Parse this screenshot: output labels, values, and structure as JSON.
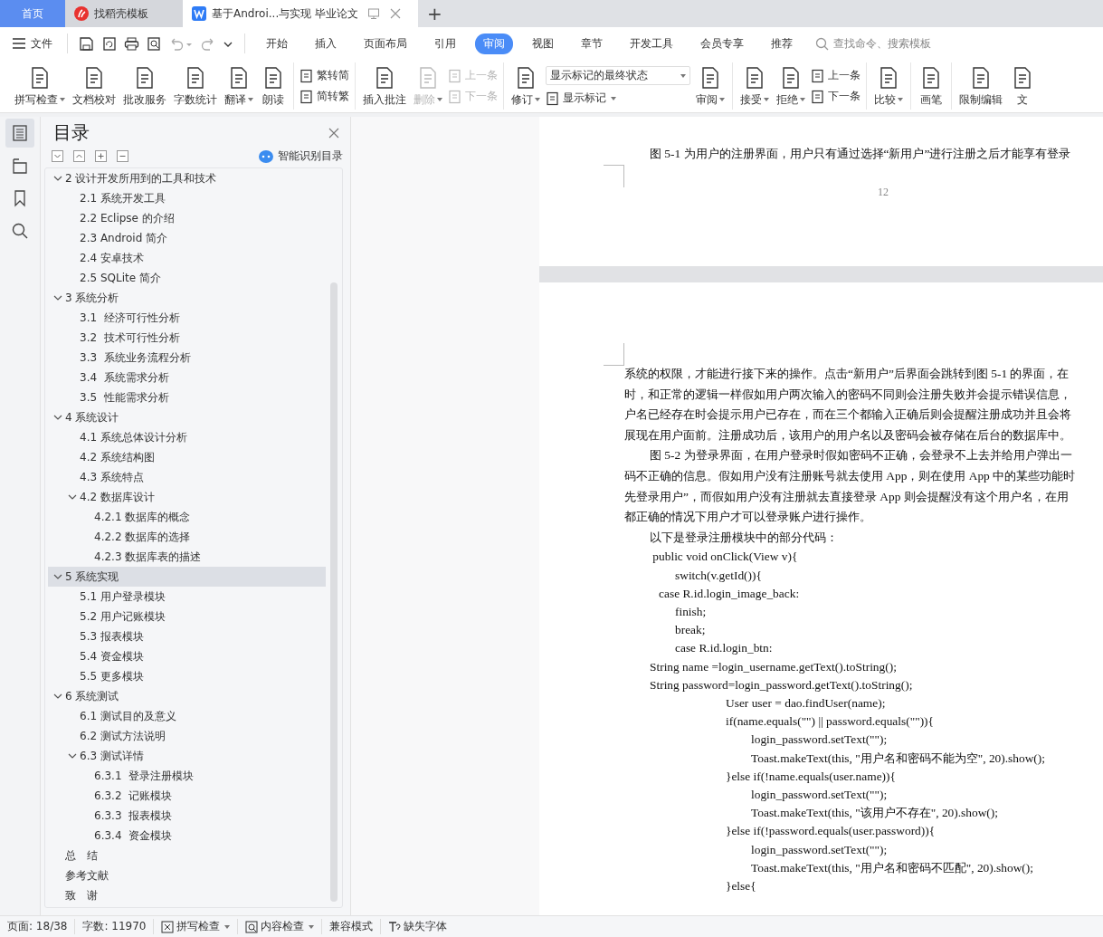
{
  "tabs": [
    {
      "label": "首页",
      "kind": "home",
      "selected": false
    },
    {
      "label": "找稻壳模板",
      "kind": "app",
      "selected": false
    },
    {
      "label": "基于Androi...与实现 毕业论文",
      "kind": "doc",
      "selected": true
    }
  ],
  "new_tab": "+",
  "menu": {
    "file": "文件",
    "tabs": [
      {
        "label": "开始",
        "selected": false
      },
      {
        "label": "插入",
        "selected": false
      },
      {
        "label": "页面布局",
        "selected": false
      },
      {
        "label": "引用",
        "selected": false
      },
      {
        "label": "审阅",
        "selected": true
      },
      {
        "label": "视图",
        "selected": false
      },
      {
        "label": "章节",
        "selected": false
      },
      {
        "label": "开发工具",
        "selected": false
      },
      {
        "label": "会员专享",
        "selected": false
      },
      {
        "label": "推荐",
        "selected": false
      }
    ],
    "search_placeholder": "查找命令、搜索模板"
  },
  "ribbon": [
    {
      "items": [
        {
          "kind": "large",
          "label": "拼写检查",
          "dropdown": true,
          "disabled": false
        },
        {
          "kind": "large",
          "label": "文档校对",
          "dropdown": false,
          "disabled": false
        },
        {
          "kind": "large",
          "label": "批改服务",
          "dropdown": false,
          "disabled": false
        },
        {
          "kind": "large",
          "label": "字数统计",
          "dropdown": false,
          "disabled": false
        },
        {
          "kind": "large",
          "label": "翻译",
          "dropdown": true,
          "disabled": false
        },
        {
          "kind": "large",
          "label": "朗读",
          "dropdown": false,
          "disabled": false
        }
      ]
    },
    {
      "items": [
        {
          "kind": "stack",
          "items": [
            {
              "label": "繁转简",
              "dropdown": false,
              "disabled": false
            },
            {
              "label": "简转繁",
              "dropdown": false,
              "disabled": false
            }
          ]
        }
      ]
    },
    {
      "items": [
        {
          "kind": "large",
          "label": "插入批注",
          "dropdown": false,
          "disabled": false
        },
        {
          "kind": "large",
          "label": "删除",
          "dropdown": true,
          "disabled": true
        },
        {
          "kind": "stack",
          "items": [
            {
              "label": "上一条",
              "dropdown": false,
              "disabled": true
            },
            {
              "label": "下一条",
              "dropdown": false,
              "disabled": true
            }
          ]
        }
      ]
    },
    {
      "items": [
        {
          "kind": "large",
          "label": "修订",
          "dropdown": true,
          "disabled": false
        },
        {
          "kind": "select",
          "value": "显示标记的最终状态",
          "items": [
            {
              "label": "显示标记",
              "dropdown": true,
              "disabled": false
            }
          ]
        },
        {
          "kind": "large",
          "label": "审阅",
          "dropdown": true,
          "disabled": false
        }
      ]
    },
    {
      "items": [
        {
          "kind": "large",
          "label": "接受",
          "dropdown": true,
          "disabled": false
        },
        {
          "kind": "large",
          "label": "拒绝",
          "dropdown": true,
          "disabled": false
        },
        {
          "kind": "stack",
          "items": [
            {
              "label": "上一条",
              "dropdown": false,
              "disabled": false
            },
            {
              "label": "下一条",
              "dropdown": false,
              "disabled": false
            }
          ]
        }
      ]
    },
    {
      "items": [
        {
          "kind": "large",
          "label": "比较",
          "dropdown": true,
          "disabled": false
        }
      ]
    },
    {
      "items": [
        {
          "kind": "large",
          "label": "画笔",
          "dropdown": false,
          "disabled": false
        }
      ]
    },
    {
      "items": [
        {
          "kind": "large",
          "label": "限制编辑",
          "dropdown": false,
          "disabled": false
        },
        {
          "kind": "large",
          "label": "文",
          "dropdown": false,
          "disabled": false
        }
      ]
    }
  ],
  "rail": [
    {
      "selected": true
    },
    {
      "selected": false
    },
    {
      "selected": false
    },
    {
      "selected": false
    }
  ],
  "toc": {
    "title": "目录",
    "smart_label": "智能识别目录",
    "items": [
      {
        "label": "2 设计开发所用到的工具和技术",
        "selected": false,
        "expanded": true,
        "children": [
          {
            "label": "2.1 系统开发工具",
            "selected": false
          },
          {
            "label": "2.2 Eclipse 的介绍",
            "selected": false
          },
          {
            "label": "2.3 Android 简介",
            "selected": false
          },
          {
            "label": "2.4 安卓技术",
            "selected": false
          },
          {
            "label": "2.5 SQLite 简介",
            "selected": false
          }
        ]
      },
      {
        "label": "3 系统分析",
        "selected": false,
        "expanded": true,
        "children": [
          {
            "label": "3.1  经济可行性分析",
            "selected": false
          },
          {
            "label": "3.2  技术可行性分析",
            "selected": false
          },
          {
            "label": "3.3  系统业务流程分析",
            "selected": false
          },
          {
            "label": "3.4  系统需求分析",
            "selected": false
          },
          {
            "label": "3.5  性能需求分析",
            "selected": false
          }
        ]
      },
      {
        "label": "4 系统设计",
        "selected": false,
        "expanded": true,
        "children": [
          {
            "label": "4.1 系统总体设计分析",
            "selected": false
          },
          {
            "label": "4.2 系统结构图",
            "selected": false
          },
          {
            "label": "4.3 系统特点",
            "selected": false
          },
          {
            "label": "4.2 数据库设计",
            "selected": false,
            "expanded": true,
            "children": [
              {
                "label": "4.2.1 数据库的概念",
                "selected": false
              },
              {
                "label": "4.2.2 数据库的选择",
                "selected": false
              },
              {
                "label": "4.2.3 数据库表的描述",
                "selected": false
              }
            ]
          }
        ]
      },
      {
        "label": "5 系统实现",
        "selected": true,
        "expanded": true,
        "children": [
          {
            "label": "5.1 用户登录模块",
            "selected": false
          },
          {
            "label": "5.2 用户记账模块",
            "selected": false
          },
          {
            "label": "5.3 报表模块",
            "selected": false
          },
          {
            "label": "5.4 资金模块",
            "selected": false
          },
          {
            "label": "5.5 更多模块",
            "selected": false
          }
        ]
      },
      {
        "label": "6 系统测试",
        "selected": false,
        "expanded": true,
        "children": [
          {
            "label": "6.1 测试目的及意义",
            "selected": false
          },
          {
            "label": "6.2 测试方法说明",
            "selected": false
          },
          {
            "label": "6.3 测试详情",
            "selected": false,
            "expanded": true,
            "children": [
              {
                "label": "6.3.1  登录注册模块",
                "selected": false
              },
              {
                "label": "6.3.2  记账模块",
                "selected": false
              },
              {
                "label": "6.3.3  报表模块",
                "selected": false
              },
              {
                "label": "6.3.4  资金模块",
                "selected": false
              }
            ]
          }
        ]
      },
      {
        "label": "总　结",
        "selected": false
      },
      {
        "label": "参考文献",
        "selected": false
      },
      {
        "label": "致　谢",
        "selected": false
      }
    ]
  },
  "document": {
    "page_1": {
      "paragraphs": [
        {
          "kind": "indent",
          "text": "图 5-1 为用户的注册界面，用户只有通过选择“新用户”进行注册之后才能享有登录"
        }
      ],
      "page_number": "12"
    },
    "page_2": {
      "paragraphs": [
        {
          "kind": "plain",
          "text": "系统的权限，才能进行接下来的操作。点击“新用户”后界面会跳转到图 5-1 的界面，在"
        },
        {
          "kind": "plain",
          "text": "时，和正常的逻辑一样假如用户两次输入的密码不同则会注册失败并会提示错误信息，"
        },
        {
          "kind": "plain",
          "text": "户名已经存在时会提示用户已存在，而在三个都输入正确后则会提醒注册成功并且会将"
        },
        {
          "kind": "plain",
          "text": "展现在用户面前。注册成功后，该用户的用户名以及密码会被存储在后台的数据库中。"
        },
        {
          "kind": "indent",
          "text": "图 5-2 为登录界面，在用户登录时假如密码不正确，会登录不上去并给用户弹出一"
        },
        {
          "kind": "plain",
          "text": "码不正确的信息。假如用户没有注册账号就去使用 App，则在使用 App 中的某些功能时"
        },
        {
          "kind": "plain",
          "text": "先登录用户”，而假如用户没有注册就去直接登录 App 则会提醒没有这个用户名，在用"
        },
        {
          "kind": "plain",
          "text": "都正确的情况下用户才可以登录账户进行操作。"
        },
        {
          "kind": "indent",
          "text": "以下是登录注册模块中的部分代码："
        },
        {
          "kind": "code",
          "text": "\t public void onClick(View v){"
        },
        {
          "kind": "code",
          "text": "\t\tswitch(v.getId()){"
        },
        {
          "kind": "code",
          "text": "\t   case R.id.login_image_back:"
        },
        {
          "kind": "code",
          "text": "\t\tfinish;"
        },
        {
          "kind": "code",
          "text": "\t\tbreak;"
        },
        {
          "kind": "code",
          "text": "\t\tcase R.id.login_btn:"
        },
        {
          "kind": "code",
          "text": "\tString name =login_username.getText().toString();"
        },
        {
          "kind": "code",
          "text": "\tString password=login_password.getText().toString();"
        },
        {
          "kind": "code",
          "text": "\t\t\t\tUser user = dao.findUser(name);"
        },
        {
          "kind": "code",
          "text": "\t\t\t\tif(name.equals(\"\") || password.equals(\"\")){"
        },
        {
          "kind": "code",
          "text": "\t\t\t\t\tlogin_password.setText(\"\");"
        },
        {
          "kind": "code",
          "text": "\t\t\t\t\tToast.makeText(this, \"用户名和密码不能为空\", 20).show();"
        },
        {
          "kind": "code",
          "text": "\t\t\t\t}else if(!name.equals(user.name)){"
        },
        {
          "kind": "code",
          "text": "\t\t\t\t\tlogin_password.setText(\"\");"
        },
        {
          "kind": "code",
          "text": "\t\t\t\t\tToast.makeText(this, \"该用户不存在\", 20).show();"
        },
        {
          "kind": "code",
          "text": "\t\t\t\t}else if(!password.equals(user.password)){"
        },
        {
          "kind": "code",
          "text": "\t\t\t\t\tlogin_password.setText(\"\");"
        },
        {
          "kind": "code",
          "text": "\t\t\t\t\tToast.makeText(this, \"用户名和密码不匹配\", 20).show();"
        },
        {
          "kind": "code",
          "text": "\t\t\t\t}else{"
        }
      ]
    }
  },
  "status_bar": [
    {
      "kind": "text",
      "label": "页面: 18/38"
    },
    {
      "kind": "text",
      "label": "字数: 11970"
    },
    {
      "kind": "spell",
      "label": "拼写检查",
      "dropdown": true
    },
    {
      "kind": "content",
      "label": "内容检查",
      "dropdown": true
    },
    {
      "kind": "text",
      "label": "兼容模式"
    },
    {
      "kind": "font",
      "label": "缺失字体",
      "dropdown": false
    }
  ]
}
